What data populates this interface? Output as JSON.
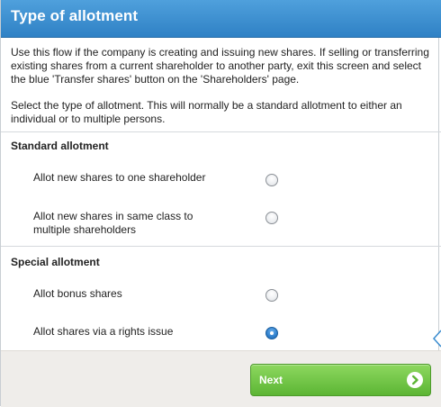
{
  "header": {
    "title": "Type of allotment"
  },
  "intro": {
    "paragraph1": "Use this flow if the company is creating and issuing new shares. If selling or transferring existing shares from a current shareholder to another party, exit this screen and select the blue 'Transfer shares' button on the 'Shareholders' page.",
    "paragraph2": "Select the type of allotment. This will normally be a standard allotment to either an individual or to multiple persons."
  },
  "sections": [
    {
      "title": "Standard allotment",
      "options": [
        {
          "label": "Allot new shares to one shareholder",
          "selected": false
        },
        {
          "label": "Allot new shares in same class to multiple shareholders",
          "selected": false
        }
      ]
    },
    {
      "title": "Special allotment",
      "options": [
        {
          "label": "Allot bonus shares",
          "selected": false
        },
        {
          "label": "Allot shares via a rights issue",
          "selected": true
        }
      ]
    }
  ],
  "footer": {
    "next_label": "Next"
  },
  "colors": {
    "header": "#3a8ccf",
    "next_button": "#6cc040",
    "radio_selected": "#2f7fcc"
  },
  "icons": {
    "next": "chevron-right-circle-icon",
    "side": "chevron-left-icon"
  }
}
